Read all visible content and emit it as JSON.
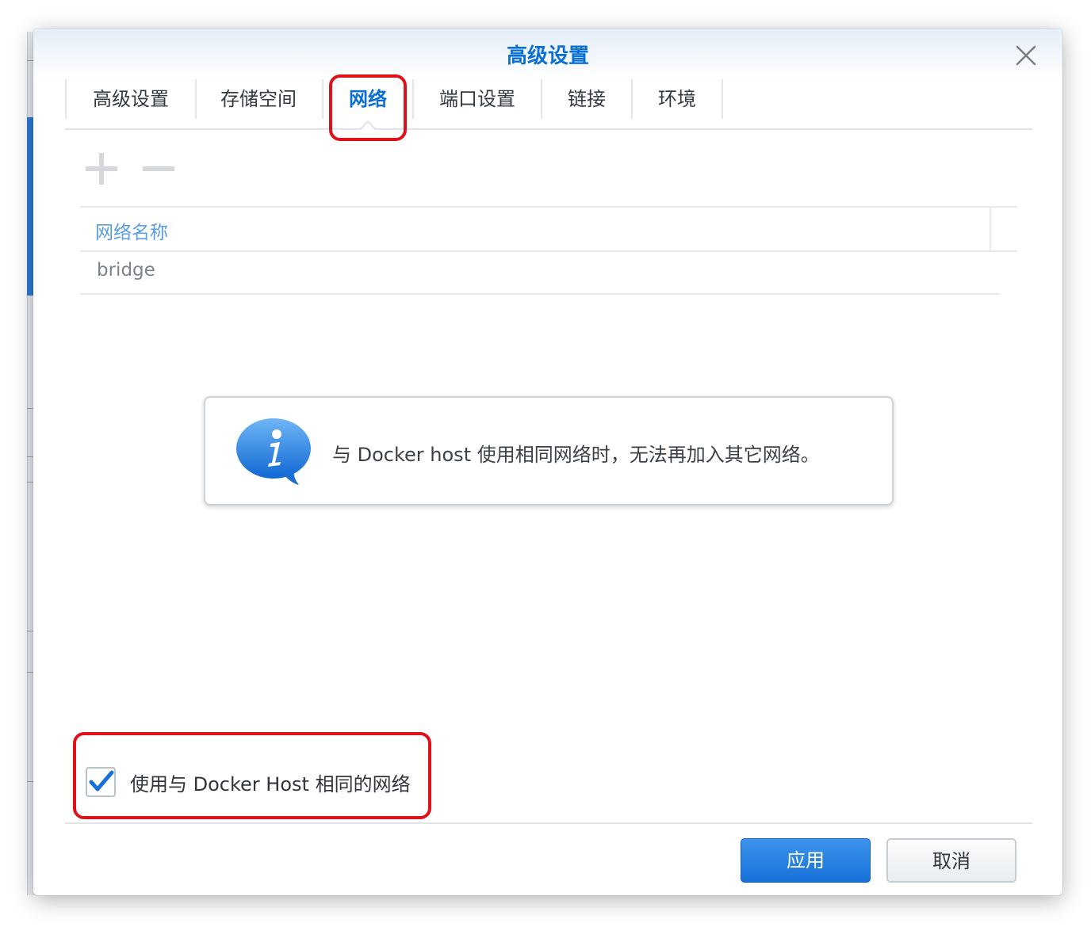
{
  "dialog": {
    "title": "高级设置",
    "close_icon": "close-icon"
  },
  "tabs": [
    {
      "label": "高级设置",
      "active": false
    },
    {
      "label": "存储空间",
      "active": false
    },
    {
      "label": "网络",
      "active": true
    },
    {
      "label": "端口设置",
      "active": false
    },
    {
      "label": "链接",
      "active": false
    },
    {
      "label": "环境",
      "active": false
    }
  ],
  "toolbar": {
    "add_icon": "plus-icon",
    "remove_icon": "minus-icon",
    "enabled": false
  },
  "network_table": {
    "columns": [
      "网络名称"
    ],
    "rows": [
      {
        "name": "bridge"
      }
    ]
  },
  "info": {
    "icon": "info-bubble-icon",
    "message": "与 Docker host 使用相同网络时，无法再加入其它网络。"
  },
  "host_network": {
    "checked": true,
    "label": "使用与 Docker Host 相同的网络"
  },
  "footer": {
    "apply_label": "应用",
    "cancel_label": "取消"
  },
  "colors": {
    "accent": "#0a6fd4",
    "highlight": "#e0101a",
    "apply_button": "#1672d8"
  }
}
